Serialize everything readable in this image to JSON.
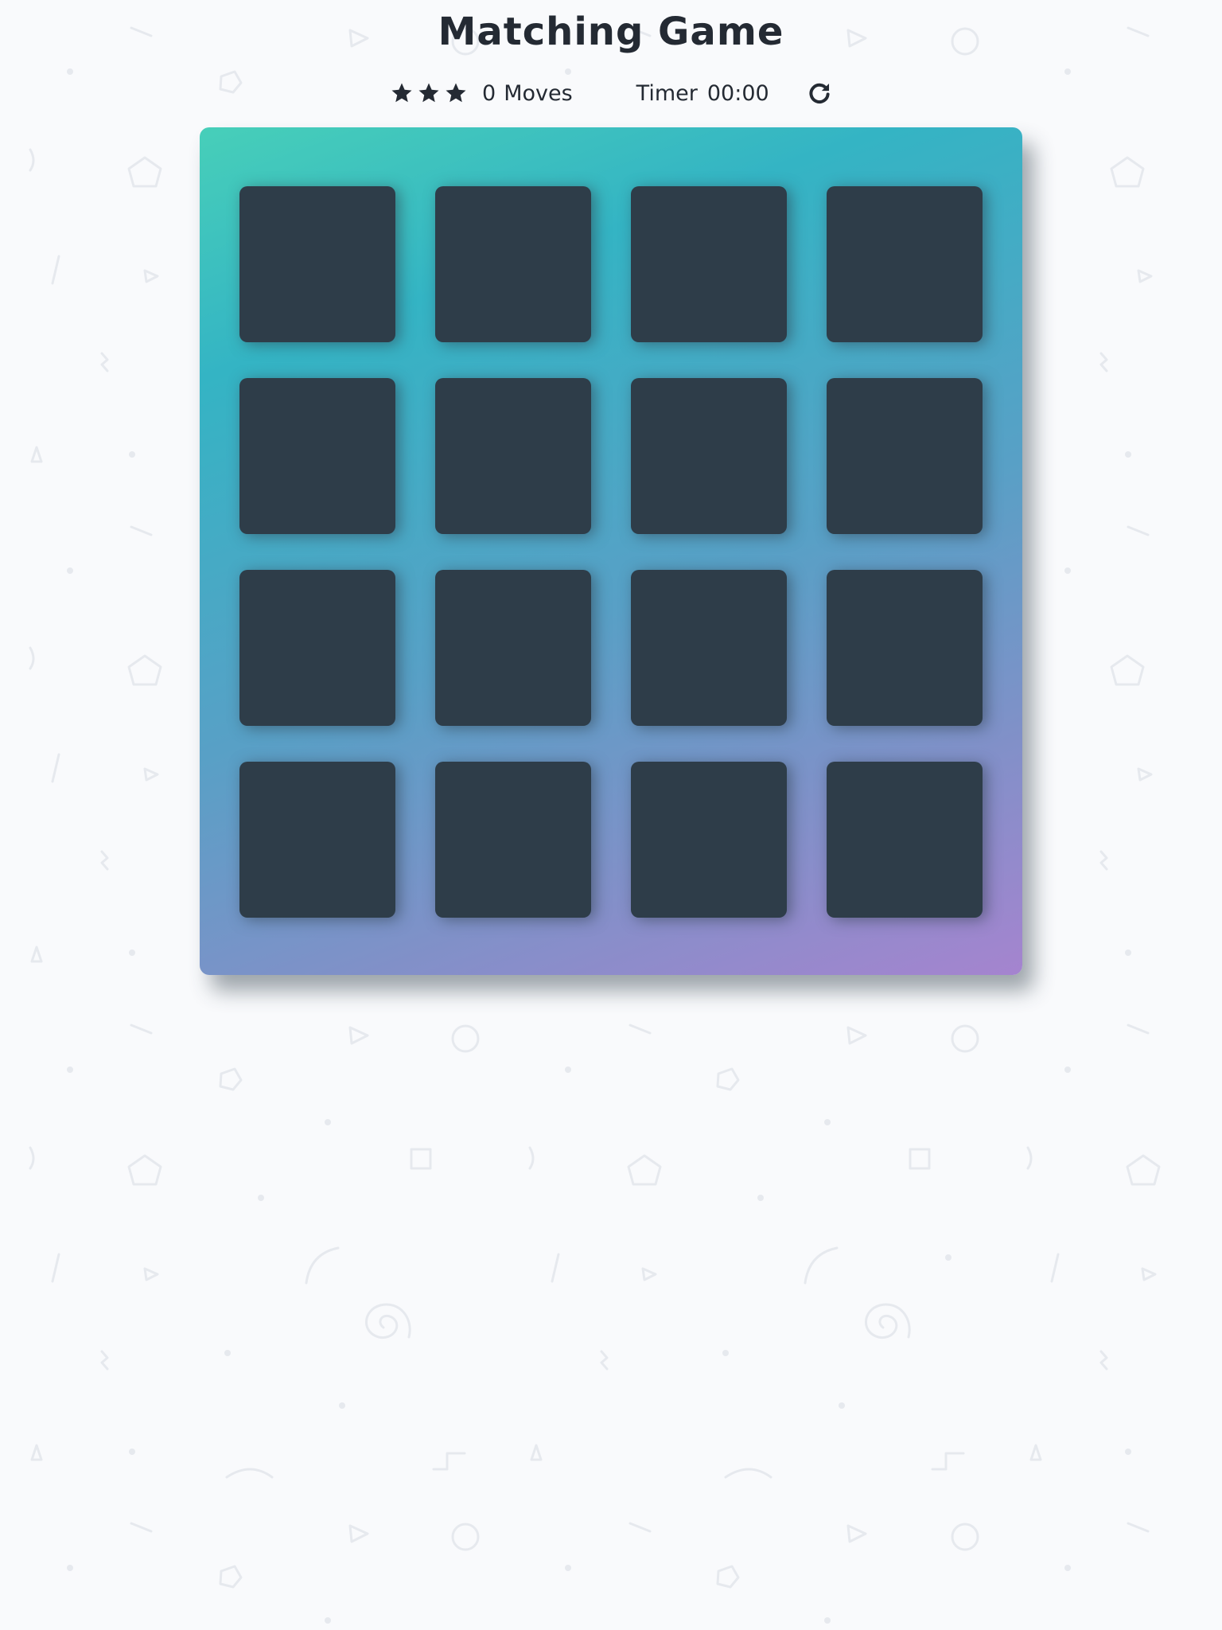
{
  "header": {
    "title": "Matching Game"
  },
  "score_panel": {
    "stars_count": 3,
    "moves_count": "0",
    "moves_label": "Moves",
    "timer_label": "Timer",
    "timer_value": "00:00",
    "restart_icon": "restart-icon"
  },
  "colors": {
    "card_back": "#2e3d49",
    "deck_gradient_start": "#47cfb9",
    "deck_gradient_end": "#a584cf",
    "page_background": "#f9fafc",
    "text": "#242a33"
  },
  "deck": {
    "rows": 4,
    "columns": 4,
    "cards": [
      {
        "state": "face-down"
      },
      {
        "state": "face-down"
      },
      {
        "state": "face-down"
      },
      {
        "state": "face-down"
      },
      {
        "state": "face-down"
      },
      {
        "state": "face-down"
      },
      {
        "state": "face-down"
      },
      {
        "state": "face-down"
      },
      {
        "state": "face-down"
      },
      {
        "state": "face-down"
      },
      {
        "state": "face-down"
      },
      {
        "state": "face-down"
      },
      {
        "state": "face-down"
      },
      {
        "state": "face-down"
      },
      {
        "state": "face-down"
      },
      {
        "state": "face-down"
      }
    ]
  }
}
